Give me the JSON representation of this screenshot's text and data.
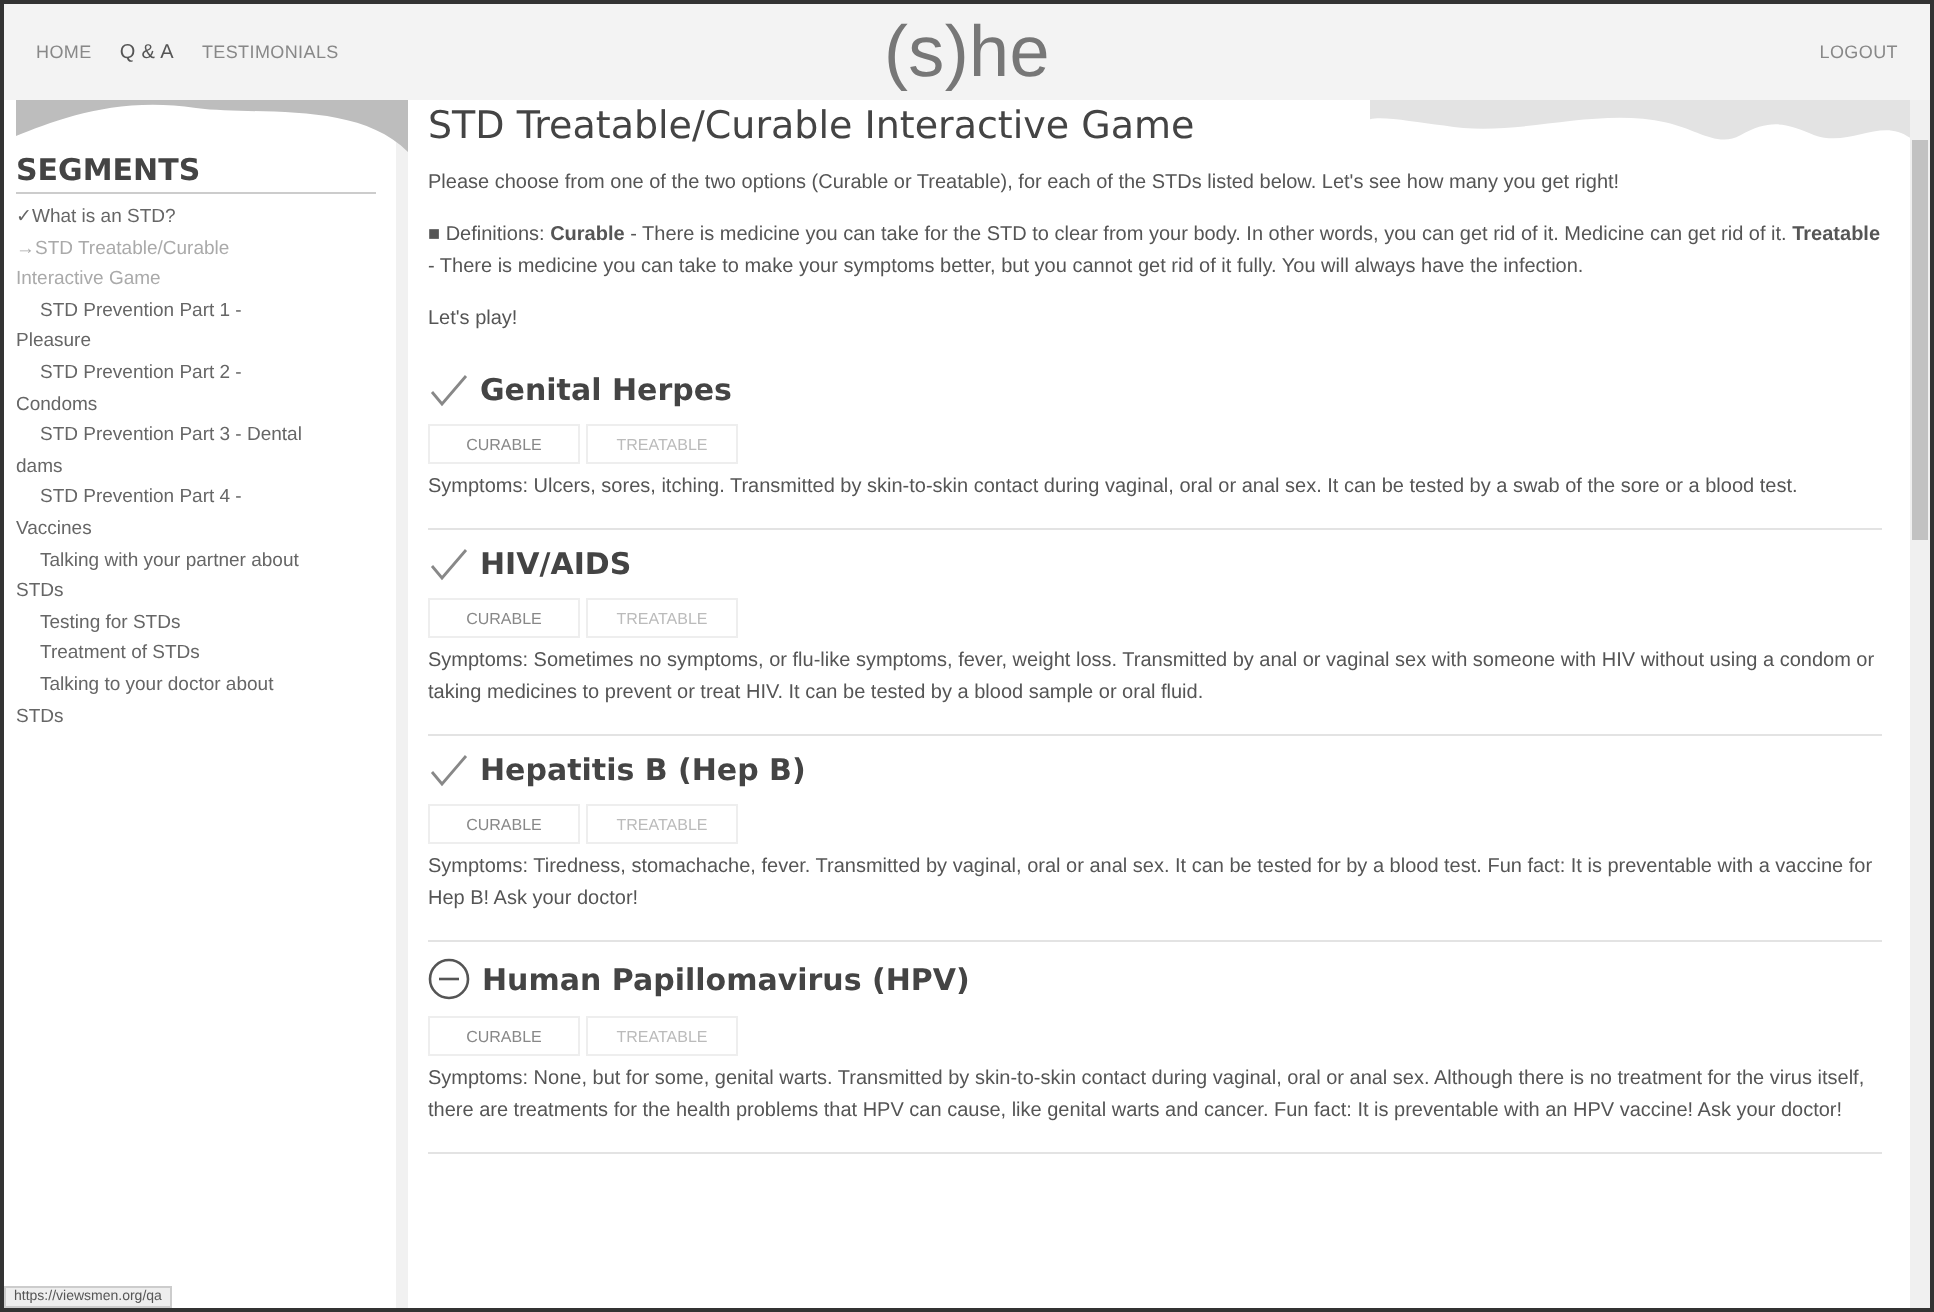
{
  "nav": {
    "links": [
      {
        "label": "HOME",
        "selected": false
      },
      {
        "label": "Q & A",
        "selected": true
      },
      {
        "label": "TESTIMONIALS",
        "selected": false
      }
    ],
    "logo": "(s)he",
    "logout": "LOGOUT"
  },
  "sidebar": {
    "title": "SEGMENTS",
    "items": [
      {
        "mark": "✓",
        "label": "What is an STD?",
        "selected": false
      },
      {
        "mark": "→",
        "label": "STD Treatable/Curable Interactive Game",
        "selected": true
      },
      {
        "label": "STD Prevention Part 1 - Pleasure",
        "selected": false
      },
      {
        "label": "STD Prevention Part 2 - Condoms",
        "selected": false
      },
      {
        "label": "STD Prevention Part 3 - Dental dams",
        "selected": false
      },
      {
        "label": "STD Prevention Part 4 - Vaccines",
        "selected": false
      },
      {
        "label": "Talking with your partner about STDs",
        "selected": false
      },
      {
        "label": "Testing for STDs",
        "selected": false
      },
      {
        "label": "Treatment of STDs",
        "selected": false
      },
      {
        "label": "Talking to your doctor about STDs",
        "selected": false
      }
    ]
  },
  "main": {
    "title": "STD Treatable/Curable Interactive Game",
    "intro": "Please choose from one of the two options (Curable or Treatable), for each of the STDs listed below. Let's see how many you get right!",
    "definitions": "■ Definitions: **Curable** - There is medicine you can take for the STD to clear from your body. In other words, you can get rid of it. Medicine can get rid of it. **Treatable** - There is medicine you can take to make your symptoms better, but you cannot get rid of it fully. You will always have the infection.",
    "lets_play": "Let's play!",
    "stds": [
      {
        "name": "Genital Herpes",
        "kind": "check",
        "options": [
          {
            "label": "CURABLE",
            "selected": false
          },
          {
            "label": "TREATABLE",
            "selected": false
          }
        ],
        "symptoms": "Symptoms: Ulcers, sores, itching. Transmitted by skin-to-skin contact during vaginal, oral or anal sex. It can be tested by a swab of the sore or a blood test."
      },
      {
        "name": "HIV/AIDS",
        "kind": "check",
        "options": [
          {
            "label": "CURABLE",
            "selected": false
          },
          {
            "label": "TREATABLE",
            "selected": false
          }
        ],
        "symptoms": "Symptoms: Sometimes no symptoms, or flu-like symptoms, fever, weight loss. Transmitted by anal or vaginal sex with someone with HIV without using a condom or taking medicines to prevent or treat HIV. It can be tested by a blood sample or oral fluid."
      },
      {
        "name": "Hepatitis B (Hep B)",
        "kind": "check",
        "options": [
          {
            "label": "CURABLE",
            "selected": false
          },
          {
            "label": "TREATABLE",
            "selected": false
          }
        ],
        "symptoms": "Symptoms: Tiredness, stomachache, fever. Transmitted by vaginal, oral or anal sex. It can be tested for by a blood test. Fun fact: It is preventable with a vaccine for Hep B! Ask your doctor!"
      },
      {
        "name": "Human Papillomavirus (HPV)",
        "kind": "minus",
        "options": [
          {
            "label": "CURABLE",
            "selected": false
          },
          {
            "label": "TREATABLE",
            "selected": false
          }
        ],
        "symptoms": "Symptoms: None, but for some, genital warts. Transmitted by skin-to-skin contact during vaginal, oral or anal sex. Although there is no treatment for the virus itself, there are treatments for the health problems that HPV can cause, like genital warts and cancer. Fun fact: It is preventable with an HPV vaccine! Ask your doctor!"
      }
    ]
  },
  "status_bar": {
    "url": "https://viewsmen.org/qa"
  }
}
